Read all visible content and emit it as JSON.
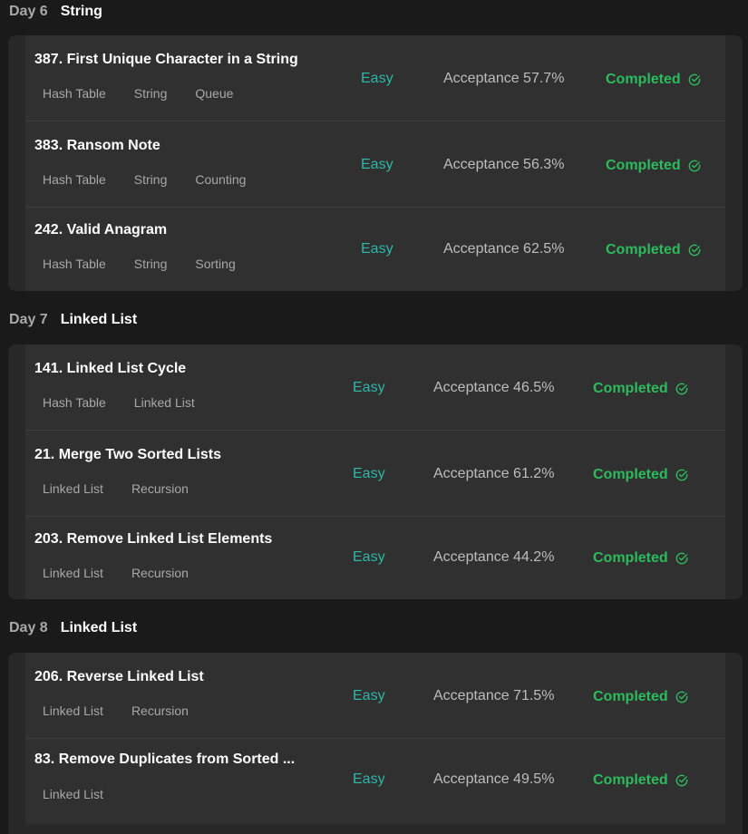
{
  "days": [
    {
      "day": "Day 6",
      "topic": "String",
      "problems": [
        {
          "title": "387. First Unique Character in a String",
          "tags": [
            "Hash Table",
            "String",
            "Queue"
          ],
          "difficulty": "Easy",
          "acceptance": "Acceptance 57.7%",
          "status": "Completed"
        },
        {
          "title": "383. Ransom Note",
          "tags": [
            "Hash Table",
            "String",
            "Counting"
          ],
          "difficulty": "Easy",
          "acceptance": "Acceptance 56.3%",
          "status": "Completed"
        },
        {
          "title": "242. Valid Anagram",
          "tags": [
            "Hash Table",
            "String",
            "Sorting"
          ],
          "difficulty": "Easy",
          "acceptance": "Acceptance 62.5%",
          "status": "Completed"
        }
      ]
    },
    {
      "day": "Day 7",
      "topic": "Linked List",
      "problems": [
        {
          "title": "141. Linked List Cycle",
          "tags": [
            "Hash Table",
            "Linked List"
          ],
          "difficulty": "Easy",
          "acceptance": "Acceptance 46.5%",
          "status": "Completed"
        },
        {
          "title": "21. Merge Two Sorted Lists",
          "tags": [
            "Linked List",
            "Recursion"
          ],
          "difficulty": "Easy",
          "acceptance": "Acceptance 61.2%",
          "status": "Completed"
        },
        {
          "title": "203. Remove Linked List Elements",
          "tags": [
            "Linked List",
            "Recursion"
          ],
          "difficulty": "Easy",
          "acceptance": "Acceptance 44.2%",
          "status": "Completed"
        }
      ]
    },
    {
      "day": "Day 8",
      "topic": "Linked List",
      "problems": [
        {
          "title": "206. Reverse Linked List",
          "tags": [
            "Linked List",
            "Recursion"
          ],
          "difficulty": "Easy",
          "acceptance": "Acceptance 71.5%",
          "status": "Completed"
        },
        {
          "title": "83. Remove Duplicates from Sorted ...",
          "tags": [
            "Linked List"
          ],
          "difficulty": "Easy",
          "acceptance": "Acceptance 49.5%",
          "status": "Completed"
        }
      ]
    }
  ],
  "colors": {
    "easy": "#2db7a8",
    "completed": "#2cbb5d",
    "background": "#1a1a1a",
    "card": "#282828",
    "row": "#303030"
  },
  "icons": {
    "status": "check-circle-icon"
  }
}
